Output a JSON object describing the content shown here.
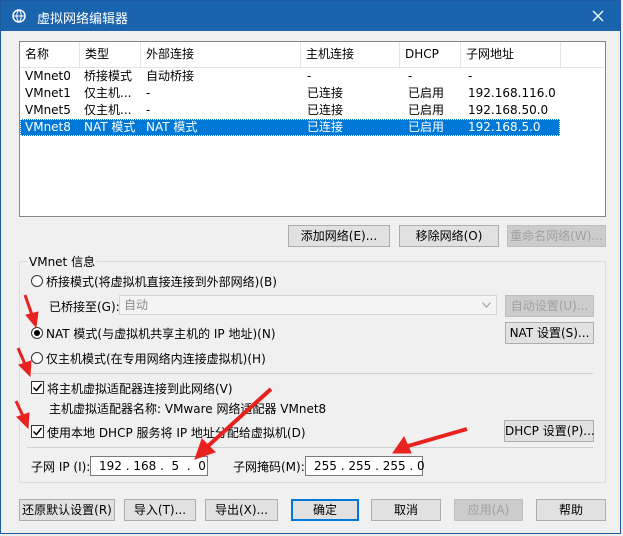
{
  "window": {
    "title": "虚拟网络编辑器"
  },
  "table": {
    "columns": [
      "名称",
      "类型",
      "外部连接",
      "主机连接",
      "DHCP",
      "子网地址"
    ],
    "rows": [
      {
        "name": "VMnet0",
        "type": "桥接模式",
        "external": "自动桥接",
        "host": "-",
        "dhcp": "-",
        "subnet": "-",
        "selected": false
      },
      {
        "name": "VMnet1",
        "type": "仅主机...",
        "external": "-",
        "host": "已连接",
        "dhcp": "已启用",
        "subnet": "192.168.116.0",
        "selected": false
      },
      {
        "name": "VMnet5",
        "type": "仅主机...",
        "external": "-",
        "host": "已连接",
        "dhcp": "已启用",
        "subnet": "192.168.50.0",
        "selected": false
      },
      {
        "name": "VMnet8",
        "type": "NAT 模式",
        "external": "NAT 模式",
        "host": "已连接",
        "dhcp": "已启用",
        "subnet": "192.168.5.0",
        "selected": true
      }
    ]
  },
  "network_buttons": {
    "add": "添加网络(E)...",
    "remove": "移除网络(O)",
    "rename": "重命名网络(W)..."
  },
  "vmnet_info": {
    "group_title": "VMnet 信息",
    "bridged_label": "桥接模式(将虚拟机直接连接到外部网络)(B)",
    "bridged_to_label": "已桥接至(G):",
    "bridged_to_value": "自动",
    "auto_settings": "自动设置(U)...",
    "nat_label": "NAT 模式(与虚拟机共享主机的 IP 地址)(N)",
    "nat_settings": "NAT 设置(S)...",
    "hostonly_label": "仅主机模式(在专用网络内连接虚拟机)(H)",
    "connect_adapter_label": "将主机虚拟适配器连接到此网络(V)",
    "adapter_name_text": "主机虚拟适配器名称: VMware 网络适配器 VMnet8",
    "dhcp_label": "使用本地 DHCP 服务将 IP 地址分配给虚拟机(D)",
    "dhcp_settings": "DHCP 设置(P)...",
    "subnet_ip_label": "子网 IP (I):",
    "subnet_ip_value": "192 . 168 .  5  .  0",
    "subnet_mask_label": "子网掩码(M):",
    "subnet_mask_value": "255 . 255 . 255 . 0",
    "selected_mode": "nat",
    "connect_adapter_checked": true,
    "dhcp_checked": true
  },
  "bottom_buttons": {
    "restore": "还原默认设置(R)",
    "import": "导入(T)...",
    "export": "导出(X)...",
    "ok": "确定",
    "cancel": "取消",
    "apply": "应用(A)",
    "help": "帮助"
  },
  "colors": {
    "titlebar": "#1a63ad",
    "selection": "#0078d7",
    "annotation_arrow": "#e8231f"
  }
}
